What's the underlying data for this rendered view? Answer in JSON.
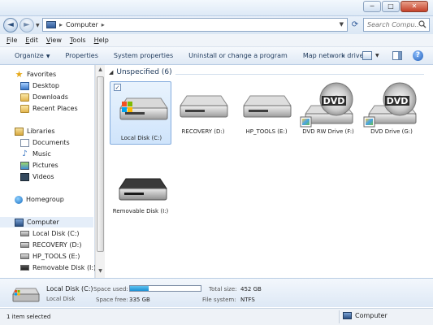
{
  "window": {
    "minimize": "─",
    "maximize": "□",
    "close": "✕"
  },
  "address": {
    "back": "◄",
    "forward": "►",
    "crumb": "Computer",
    "search_placeholder": "Search Compu..."
  },
  "menu": [
    "File",
    "Edit",
    "View",
    "Tools",
    "Help"
  ],
  "toolbar": {
    "items": [
      "Organize",
      "Properties",
      "System properties",
      "Uninstall or change a program",
      "Map network drive"
    ],
    "more": "»"
  },
  "nav": {
    "favorites": "Favorites",
    "desktop": "Desktop",
    "downloads": "Downloads",
    "recent": "Recent Places",
    "libraries": "Libraries",
    "documents": "Documents",
    "music": "Music",
    "pictures": "Pictures",
    "videos": "Videos",
    "homegroup": "Homegroup",
    "computer": "Computer",
    "drives": [
      "Local Disk (C:)",
      "RECOVERY (D:)",
      "HP_TOOLS (E:)",
      "Removable Disk (I:)"
    ]
  },
  "content": {
    "group": "Unspecified (6)",
    "drives": [
      {
        "label": "Local Disk (C:)",
        "kind": "hdd-windows",
        "selected": true
      },
      {
        "label": "RECOVERY (D:)",
        "kind": "hdd"
      },
      {
        "label": "HP_TOOLS (E:)",
        "kind": "hdd"
      },
      {
        "label": "DVD RW Drive (F:)",
        "kind": "dvd"
      },
      {
        "label": "DVD Drive (G:)",
        "kind": "dvd"
      },
      {
        "label": "Removable Disk (I:)",
        "kind": "removable"
      }
    ],
    "dvd_text": "DVD"
  },
  "details": {
    "name": "Local Disk (C:)",
    "type": "Local Disk",
    "space_used_label": "Space used:",
    "space_used_fraction": 0.26,
    "space_free_label": "Space free:",
    "space_free": "335 GB",
    "total_size_label": "Total size:",
    "total_size": "452 GB",
    "fs_label": "File system:",
    "fs": "NTFS"
  },
  "status": {
    "left": "1 item selected",
    "right": "Computer"
  },
  "colors": {
    "accent": "#1e395b",
    "selection": "#cfe4fb",
    "usage_bar": "#1b8fd3"
  }
}
